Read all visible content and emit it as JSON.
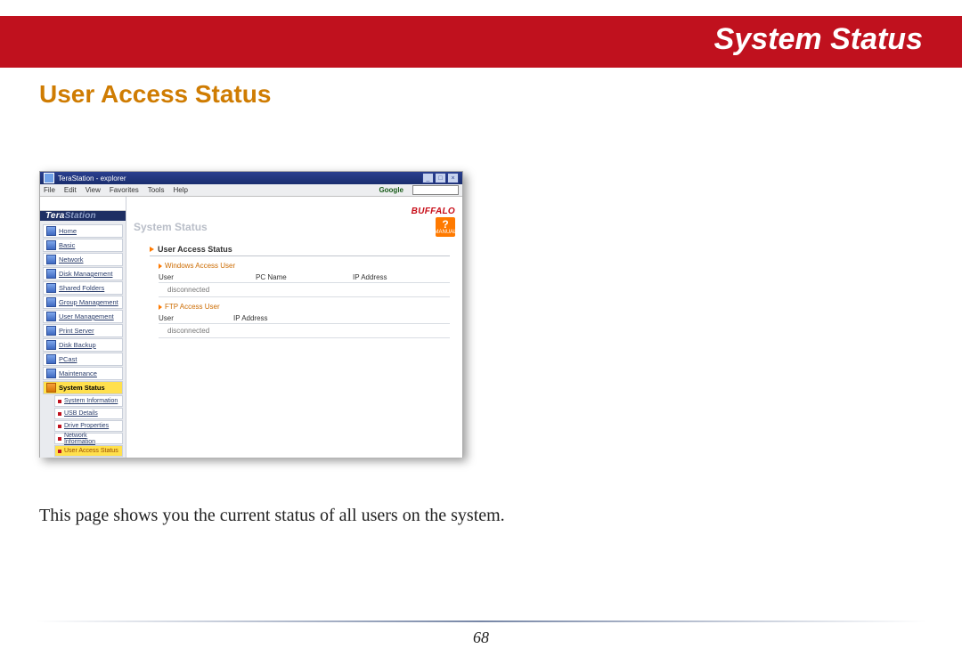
{
  "banner_title": "System Status",
  "section_title": "User Access Status",
  "description": "This page shows you the current status of all users on the system.",
  "page_number": "68",
  "screenshot": {
    "window_title": "TeraStation - explorer",
    "menubar": [
      "File",
      "Edit",
      "View",
      "Favorites",
      "Tools",
      "Help"
    ],
    "google_label": "Google",
    "brand": "TeraStation",
    "logo": "BUFFALO",
    "crumb": "System Status",
    "manual_label": "MANUAL",
    "nav": [
      {
        "label": "Home"
      },
      {
        "label": "Basic"
      },
      {
        "label": "Network"
      },
      {
        "label": "Disk Management"
      },
      {
        "label": "Shared Folders"
      },
      {
        "label": "Group Management"
      },
      {
        "label": "User Management"
      },
      {
        "label": "Print Server"
      },
      {
        "label": "Disk Backup"
      },
      {
        "label": "PCast"
      },
      {
        "label": "Maintenance"
      },
      {
        "label": "System Status",
        "selected": true
      }
    ],
    "subnav": [
      {
        "label": "System Information"
      },
      {
        "label": "USB Details"
      },
      {
        "label": "Drive Properties"
      },
      {
        "label": "Network Information"
      },
      {
        "label": "User Access Status",
        "selected": true
      }
    ],
    "panel_title": "User Access Status",
    "windows_section": {
      "title": "Windows Access User",
      "cols": [
        "User",
        "PC Name",
        "IP Address"
      ],
      "value": "disconnected"
    },
    "ftp_section": {
      "title": "FTP Access User",
      "cols": [
        "User",
        "IP Address"
      ],
      "value": "disconnected"
    }
  }
}
